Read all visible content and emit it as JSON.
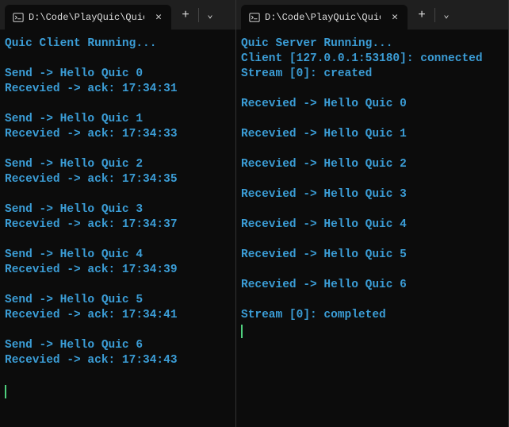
{
  "panes": [
    {
      "tab": {
        "title": "D:\\Code\\PlayQuic\\QuicClient\\"
      },
      "lines": [
        "Quic Client Running...",
        "",
        "Send -> Hello Quic 0",
        "Recevied -> ack: 17:34:31",
        "",
        "Send -> Hello Quic 1",
        "Recevied -> ack: 17:34:33",
        "",
        "Send -> Hello Quic 2",
        "Recevied -> ack: 17:34:35",
        "",
        "Send -> Hello Quic 3",
        "Recevied -> ack: 17:34:37",
        "",
        "Send -> Hello Quic 4",
        "Recevied -> ack: 17:34:39",
        "",
        "Send -> Hello Quic 5",
        "Recevied -> ack: 17:34:41",
        "",
        "Send -> Hello Quic 6",
        "Recevied -> ack: 17:34:43",
        ""
      ]
    },
    {
      "tab": {
        "title": "D:\\Code\\PlayQuic\\QuicServer"
      },
      "lines": [
        "Quic Server Running...",
        "Client [127.0.0.1:53180]: connected",
        "Stream [0]: created",
        "",
        "Recevied -> Hello Quic 0",
        "",
        "Recevied -> Hello Quic 1",
        "",
        "Recevied -> Hello Quic 2",
        "",
        "Recevied -> Hello Quic 3",
        "",
        "Recevied -> Hello Quic 4",
        "",
        "Recevied -> Hello Quic 5",
        "",
        "Recevied -> Hello Quic 6",
        "",
        "Stream [0]: completed"
      ]
    }
  ]
}
